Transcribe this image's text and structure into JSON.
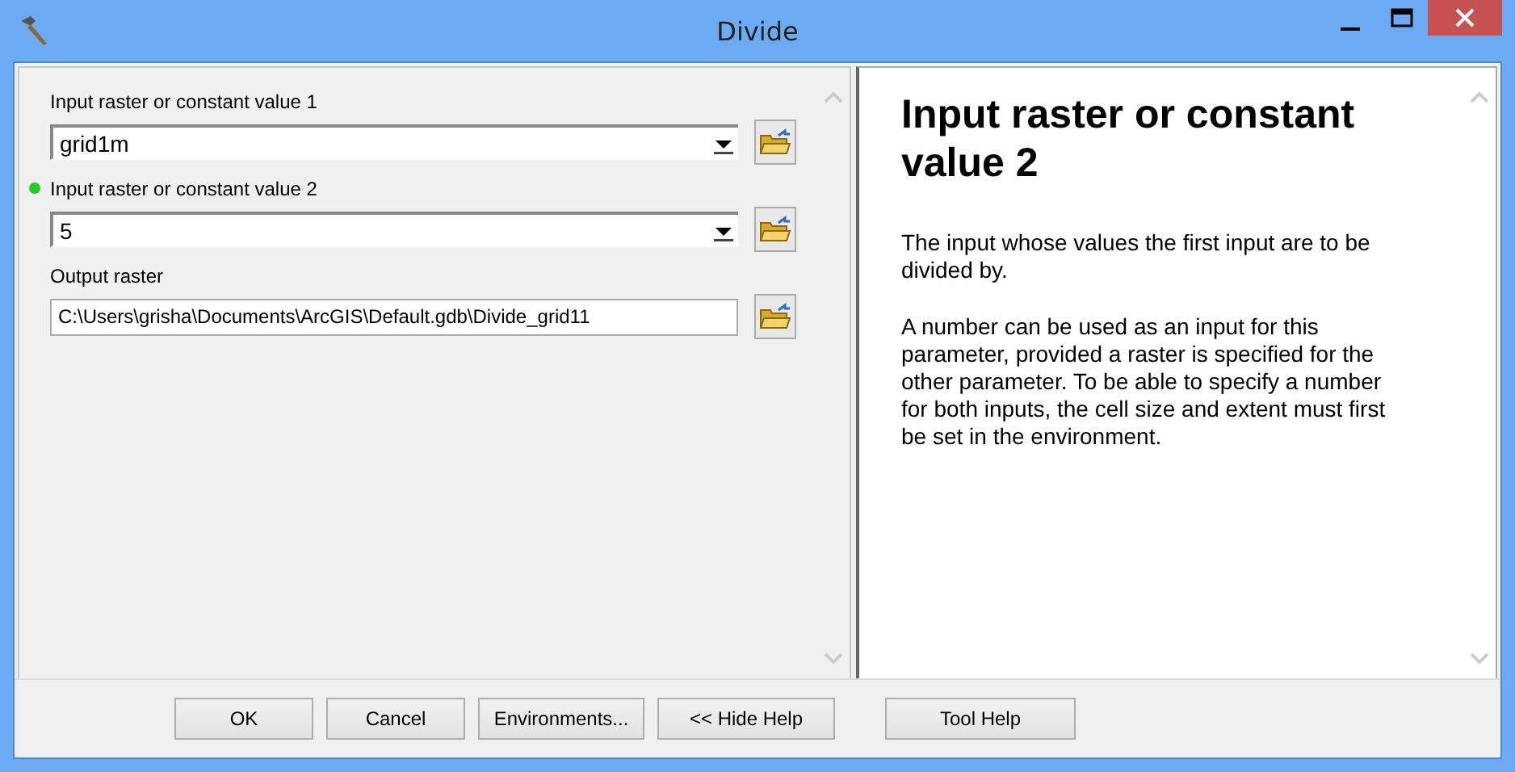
{
  "window": {
    "title": "Divide"
  },
  "parameters": [
    {
      "label": "Input raster or constant value 1",
      "value": "grid1m",
      "kind": "combo",
      "selected": false
    },
    {
      "label": "Input raster or constant value 2",
      "value": "5",
      "kind": "combo",
      "selected": true
    },
    {
      "label": "Output raster",
      "value": "C:\\Users\\grisha\\Documents\\ArcGIS\\Default.gdb\\Divide_grid11",
      "kind": "text",
      "selected": false
    }
  ],
  "help": {
    "title": "Input raster or constant value 2",
    "paragraphs": [
      "The input whose values the first input are to be divided by.",
      "A number can be used as an input for this parameter, provided a raster is specified for the other parameter. To be able to specify a number for both inputs, the cell size and extent must first be set in the environment."
    ]
  },
  "buttons": [
    "OK",
    "Cancel",
    "Environments...",
    "<< Hide Help",
    "Tool Help"
  ]
}
